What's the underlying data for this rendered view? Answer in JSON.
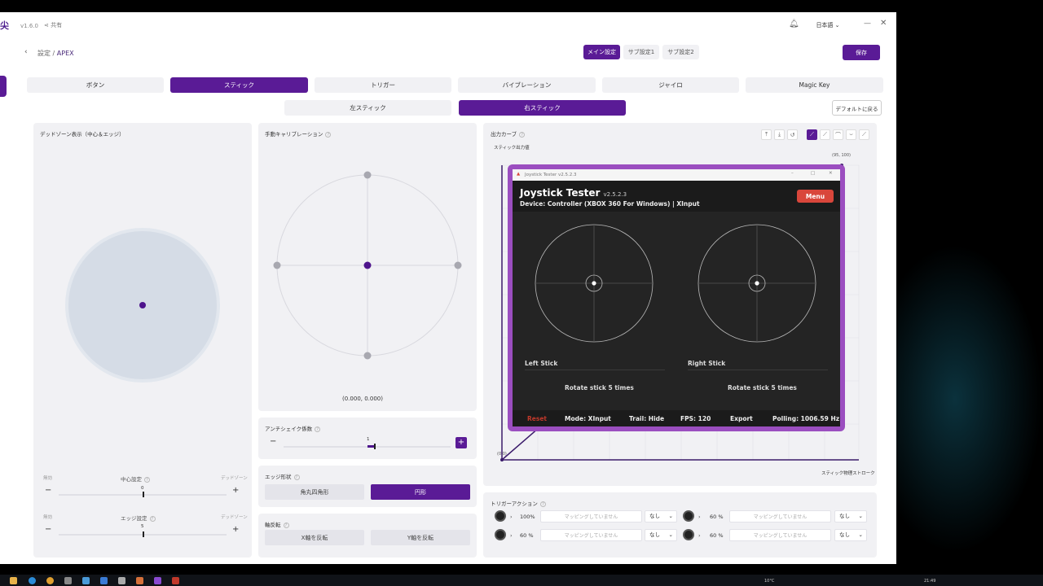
{
  "app": {
    "logo": "尖",
    "version": "v1.6.0",
    "share_label": "共有",
    "language": "日本語",
    "breadcrumb_root": "設定",
    "breadcrumb_sep": "/",
    "breadcrumb_current": "APEX",
    "settings_tabs": [
      "メイン設定",
      "サブ設定1",
      "サブ設定2"
    ],
    "save_label": "保存"
  },
  "tabs": [
    "ボタン",
    "スティック",
    "トリガー",
    "バイブレーション",
    "ジャイロ",
    "Magic Key"
  ],
  "subtabs": [
    "左スティック",
    "右スティック"
  ],
  "default_button": "デフォルトに戻る",
  "deadzone": {
    "title": "デッドゾーン表示（中心＆エッジ）",
    "center": {
      "left": "無効",
      "label": "中心設定",
      "right": "デッドゾーン",
      "value": "0",
      "level": 0.5
    },
    "edge": {
      "left": "無効",
      "label": "エッジ設定",
      "right": "デッドゾーン",
      "value": "5",
      "level": 0.5
    }
  },
  "calibration": {
    "title": "手動キャリブレーション",
    "coords": "(0.000, 0.000)"
  },
  "antishake": {
    "title": "アンチシェイク係数",
    "value": "1"
  },
  "edge_shape": {
    "title": "エッジ形状",
    "options": [
      "角丸四角形",
      "円形"
    ],
    "selected": "円形"
  },
  "axis_invert": {
    "title": "軸反転",
    "options": [
      "X軸を反転",
      "Y軸を反転"
    ]
  },
  "output_curve": {
    "title": "出力カーブ",
    "y_label": "スティック出力値",
    "x_label": "スティック物理ストローク",
    "point_label": "(95, 100)",
    "origin_label": "(0,0)"
  },
  "joystick_tester": {
    "window_title": "Joystick Tester v2.5.2.3",
    "title": "Joystick Tester",
    "version": "v2.5.2.3",
    "device": "Device: Controller (XBOX 360 For Windows) | XInput",
    "menu_label": "Menu",
    "left_stick": "Left Stick",
    "right_stick": "Right Stick",
    "left_hint": "Rotate stick 5 times",
    "right_hint": "Rotate stick 5 times",
    "footer": {
      "reset": "Reset",
      "mode": "Mode: XInput",
      "trail": "Trail: Hide",
      "fps": "FPS: 120",
      "export": "Export",
      "polling": "Polling: 1006.59 Hz"
    }
  },
  "trigger_action": {
    "title": "トリガーアクション",
    "rows": [
      {
        "pct": "100%",
        "mapping": "マッピングしていません",
        "select": "なし"
      },
      {
        "pct": "60 %",
        "mapping": "マッピングしていません",
        "select": "なし"
      },
      {
        "pct": "60 %",
        "mapping": "マッピングしていません",
        "select": "なし"
      },
      {
        "pct": "60 %",
        "mapping": "マッピングしていません",
        "select": "なし"
      }
    ]
  },
  "taskbar": {
    "weather": "10°C",
    "time": "21:49"
  },
  "colors": {
    "accent": "#5a1b96",
    "panel": "#f1f1f4",
    "tester_frame": "#9b4ec0",
    "reset_red": "#d9463b"
  }
}
